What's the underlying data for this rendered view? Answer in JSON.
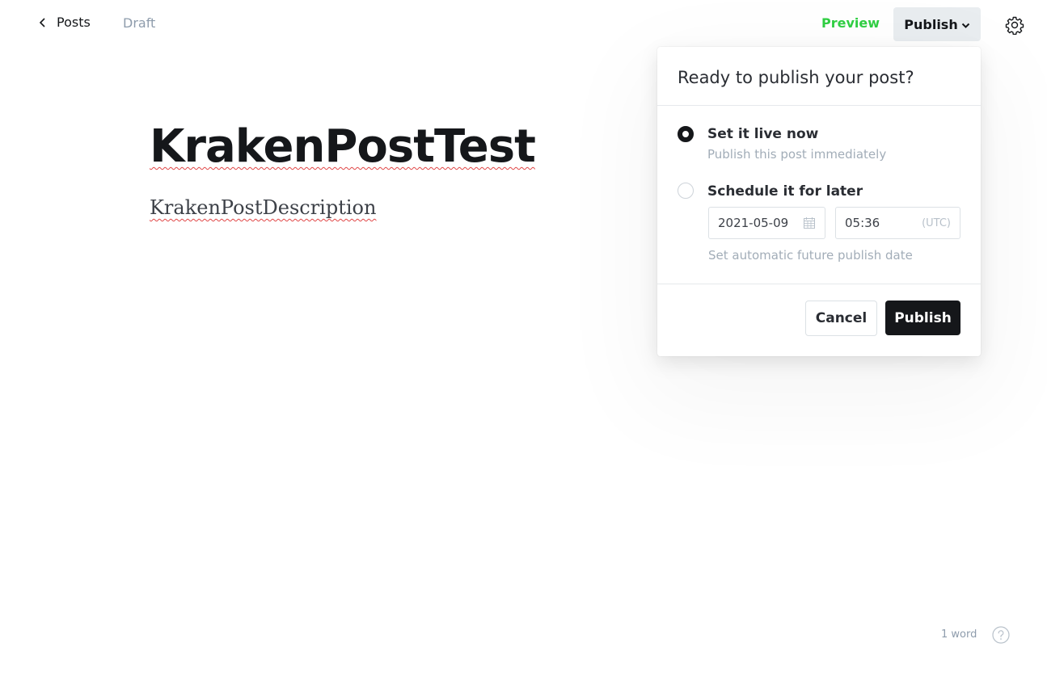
{
  "header": {
    "back_label": "Posts",
    "status": "Draft",
    "preview_label": "Preview",
    "publish_label": "Publish",
    "icons": {
      "back": "chevron-left-icon",
      "publish_menu": "chevron-down-icon",
      "settings": "gear-icon"
    }
  },
  "editor": {
    "title": "KrakenPostTest",
    "excerpt": "KrakenPostDescription"
  },
  "publish_menu": {
    "heading": "Ready to publish your post?",
    "options": [
      {
        "label": "Set it live now",
        "description": "Publish this post immediately",
        "selected": true
      },
      {
        "label": "Schedule it for later",
        "selected": false
      }
    ],
    "schedule": {
      "date": "2021-05-09",
      "time": "05:36",
      "timezone": "(UTC)",
      "hint": "Set automatic future publish date"
    },
    "cancel_label": "Cancel",
    "confirm_label": "Publish"
  },
  "footer": {
    "word_count": "1 word",
    "help_icon": "question-circle-icon"
  },
  "colors": {
    "accent_green": "#30cf43",
    "primary_dark": "#15171a",
    "muted_text": "#8e9cac",
    "spellcheck_underline": "#e04646"
  }
}
